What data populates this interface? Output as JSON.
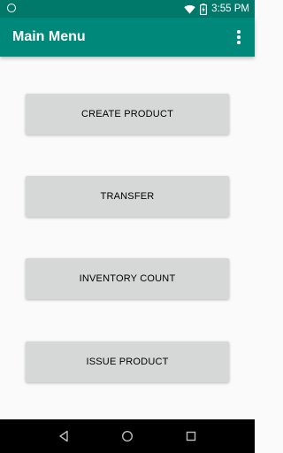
{
  "status_bar": {
    "time": "3:55 PM",
    "icons": [
      "notification-circle-icon",
      "wifi-icon",
      "battery-charging-icon"
    ]
  },
  "app_bar": {
    "title": "Main Menu",
    "overflow_icon": "more-vert-icon"
  },
  "menu": {
    "buttons": [
      {
        "label": "CREATE PRODUCT"
      },
      {
        "label": "TRANSFER"
      },
      {
        "label": "INVENTORY COUNT"
      },
      {
        "label": "ISSUE PRODUCT"
      }
    ]
  },
  "nav_bar": {
    "icons": [
      "back-icon",
      "home-icon",
      "recents-icon"
    ]
  },
  "colors": {
    "status_bar": "#00796b",
    "app_bar": "#00897b",
    "button_bg": "#d6d7d7",
    "background": "#fafafa"
  }
}
